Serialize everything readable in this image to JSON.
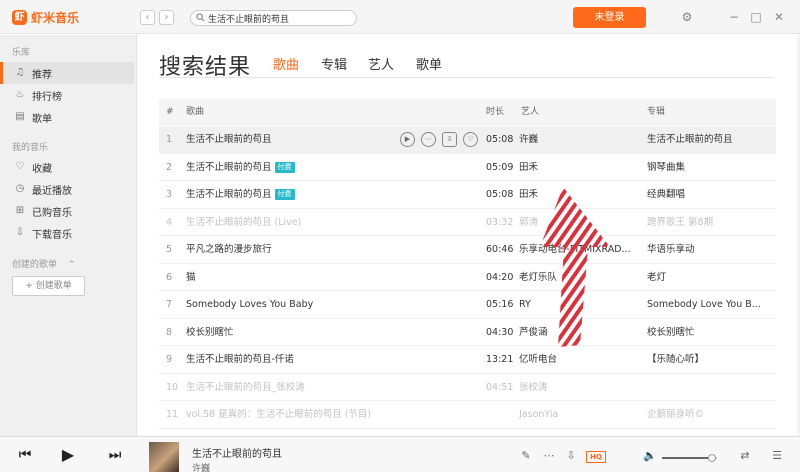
{
  "app": {
    "name": "虾米音乐",
    "logo_mark": "虾"
  },
  "titlebar": {
    "back": "‹",
    "forward": "›",
    "search_value": "生活不止眼前的苟且",
    "login_label": "未登录"
  },
  "sidebar": {
    "library_heading": "乐库",
    "library_items": [
      {
        "label": "推荐",
        "icon": "music-note-icon",
        "glyph": "♫",
        "active": true
      },
      {
        "label": "排行榜",
        "icon": "flame-icon",
        "glyph": "♨"
      },
      {
        "label": "歌单",
        "icon": "playlist-icon",
        "glyph": "▤"
      }
    ],
    "my_music_heading": "我的音乐",
    "my_items": [
      {
        "label": "收藏",
        "icon": "heart-icon",
        "glyph": "♡"
      },
      {
        "label": "最近播放",
        "icon": "clock-icon",
        "glyph": "◷"
      },
      {
        "label": "已购音乐",
        "icon": "cart-icon",
        "glyph": "⊞"
      },
      {
        "label": "下载音乐",
        "icon": "download-icon",
        "glyph": "⇩"
      }
    ],
    "created_heading": "创建的歌单",
    "create_button": "+ 创建歌单"
  },
  "main": {
    "title": "搜索结果",
    "tabs": [
      "歌曲",
      "专辑",
      "艺人",
      "歌单"
    ],
    "active_tab": 0,
    "columns": {
      "num": "#",
      "song": "歌曲",
      "duration": "时长",
      "artist": "艺人",
      "album": "专辑"
    },
    "rows": [
      {
        "num": "1",
        "song": "生活不止眼前的苟且",
        "duration": "05:08",
        "artist": "许巍",
        "album": "生活不止眼前的苟且",
        "hover": true
      },
      {
        "num": "2",
        "song": "生活不止眼前的苟且",
        "tag": "付费",
        "duration": "05:09",
        "artist": "田禾",
        "album": "钢琴曲集"
      },
      {
        "num": "3",
        "song": "生活不止眼前的苟且",
        "tag": "付费",
        "duration": "05:08",
        "artist": "田禾",
        "album": "经典翻唱"
      },
      {
        "num": "4",
        "song": "生活不止眼前的苟且 (Live)",
        "duration": "03:32",
        "artist": "郭涛",
        "album": "跨界歌王 第8期",
        "grey": true
      },
      {
        "num": "5",
        "song": "平凡之路的漫步旅行",
        "duration": "60:46",
        "artist": "乐享动电台-FITMIXRAD...",
        "album": "华语乐享动"
      },
      {
        "num": "6",
        "song": "猫",
        "duration": "04:20",
        "artist": "老灯乐队",
        "album": "老灯"
      },
      {
        "num": "7",
        "song": "Somebody Loves You Baby",
        "duration": "05:16",
        "artist": "RY",
        "album": "Somebody Love You B..."
      },
      {
        "num": "8",
        "song": "校长别瞎忙",
        "duration": "04:30",
        "artist": "芦俊涵",
        "album": "校长别瞎忙"
      },
      {
        "num": "9",
        "song": "生活不止眼前的苟且-仟诺",
        "duration": "13:21",
        "artist": "亿听电台",
        "album": "【乐随心听】"
      },
      {
        "num": "10",
        "song": "生活不止眼前的苟且_张校涛",
        "duration": "04:51",
        "artist": "张校涛",
        "album": "",
        "grey": true
      },
      {
        "num": "11",
        "song": "vol.58 是真的：生活不止眼前的苟且 (节目)",
        "duration": "",
        "artist": "JasonYia",
        "album": "企鹅丽身听©",
        "grey": true
      }
    ],
    "row_action_icons": [
      "play-circle-icon",
      "more-circle-icon",
      "download-icon",
      "heart-icon"
    ]
  },
  "player": {
    "track_title": "生活不止眼前的苟且",
    "track_artist": "许巍",
    "hq_label": "HQ",
    "volume": 0.9
  },
  "colors": {
    "accent": "#ff6a1a",
    "tag": "#29b8c8",
    "arrow": "#d9323c"
  }
}
